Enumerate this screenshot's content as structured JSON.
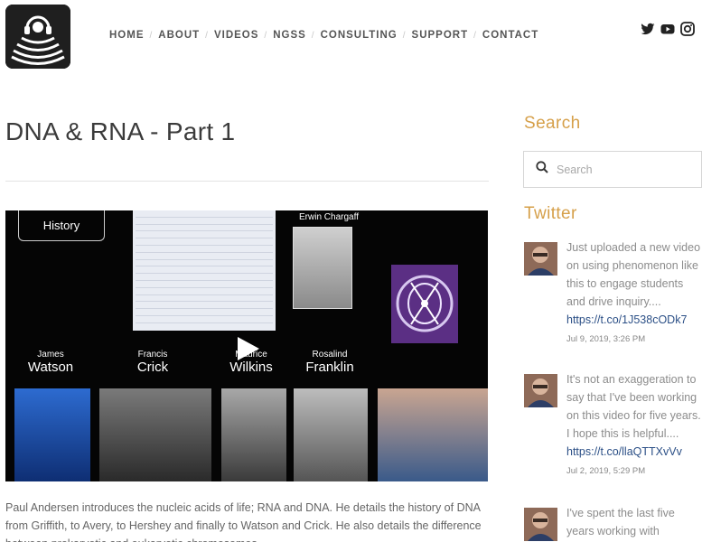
{
  "nav": {
    "items": [
      {
        "label": "HOME"
      },
      {
        "label": "ABOUT"
      },
      {
        "label": "VIDEOS"
      },
      {
        "label": "NGSS"
      },
      {
        "label": "CONSULTING"
      },
      {
        "label": "SUPPORT"
      },
      {
        "label": "CONTACT"
      }
    ],
    "separator": "/"
  },
  "social": {
    "icons": [
      "twitter-icon",
      "youtube-icon",
      "instagram-icon"
    ]
  },
  "post": {
    "title": "DNA & RNA - Part 1",
    "video": {
      "history_label": "History",
      "chargaff_label": "Erwin Chargaff",
      "scientists": [
        {
          "first": "James",
          "last": "Watson"
        },
        {
          "first": "Francis",
          "last": "Crick"
        },
        {
          "first": "Maurice",
          "last": "Wilkins"
        },
        {
          "first": "Rosalind",
          "last": "Franklin"
        }
      ]
    },
    "summary": "Paul Andersen introduces the nucleic acids of life; RNA and DNA. He details the history of DNA from Griffith, to Avery, to Hershey and finally to Watson and Crick. He also details the difference between prokaryotic and eukaryotic chromosomes."
  },
  "sidebar": {
    "search_title": "Search",
    "search_placeholder": "Search",
    "twitter_title": "Twitter",
    "tweets": [
      {
        "text": "Just uploaded a new video on using phenomenon like this to engage students and drive inquiry....",
        "link": "https://t.co/1J538cODk7",
        "date": "Jul 9, 2019, 3:26 PM"
      },
      {
        "text": "It's not an exaggeration to say that I've been working on this video for five years. I hope this is helpful....",
        "link": "https://t.co/llaQTTXvVv",
        "date": "Jul 2, 2019, 5:29 PM"
      },
      {
        "text": "I've spent the last five years working with"
      }
    ]
  },
  "colors": {
    "accent": "#d6a04a",
    "link": "#2b4f86",
    "nav_text": "#555555"
  }
}
